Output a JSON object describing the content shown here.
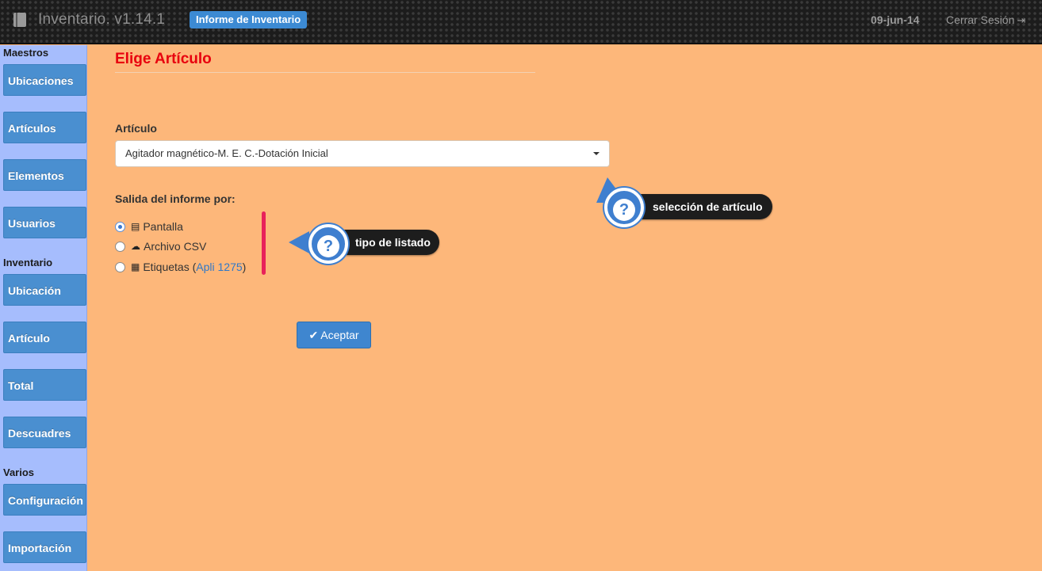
{
  "header": {
    "app_title": "Inventario. v1.14.1",
    "page_badge": "Informe de Inventario",
    "date": "09-jun-14",
    "logout_label": "Cerrar Sesión",
    "logout_icon": "sign-out-icon",
    "app_icon": "book-icon"
  },
  "sidebar": {
    "sections": [
      {
        "title": "Maestros"
      },
      {
        "title": "Inventario"
      },
      {
        "title": "Varios"
      }
    ],
    "items": [
      {
        "label": "Ubicaciones"
      },
      {
        "label": "Artículos"
      },
      {
        "label": "Elementos"
      },
      {
        "label": "Usuarios"
      },
      {
        "label": "Ubicación"
      },
      {
        "label": "Artículo"
      },
      {
        "label": "Total"
      },
      {
        "label": "Descuadres"
      },
      {
        "label": "Configuración"
      },
      {
        "label": "Importación"
      }
    ]
  },
  "main": {
    "title": "Elige Artículo",
    "article_label": "Artículo",
    "article_selected": "Agitador magnético-M. E. C.-Dotación Inicial",
    "output_label": "Salida del informe por:",
    "options": [
      {
        "label": "Pantalla",
        "icon": "list-icon",
        "checked": true
      },
      {
        "label": "Archivo CSV",
        "icon": "cloud-download-icon",
        "checked": false
      },
      {
        "label": "Etiquetas (",
        "link": "Apli 1275",
        "suffix": ")",
        "icon": "qrcode-icon",
        "checked": false
      }
    ],
    "accept_label": "Aceptar"
  },
  "help": {
    "article_tip": "selección de artículo",
    "list_tip": "tipo de listado"
  },
  "colors": {
    "background": "#fdb77a",
    "sidebar": "#a6bdfd",
    "button": "#4a8fd0",
    "title": "#e8000e",
    "badge": "#3c8ad3"
  }
}
